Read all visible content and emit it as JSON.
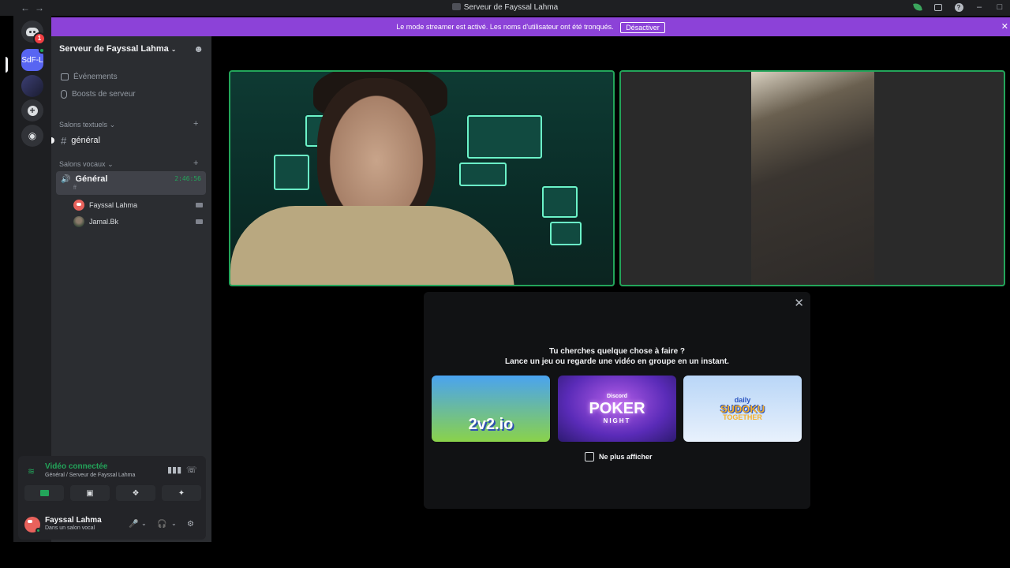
{
  "window": {
    "title": "Serveur de Fayssal Lahma",
    "nav_back": "←",
    "nav_forward": "→",
    "minimize": "–",
    "maximize": "□",
    "help": "?"
  },
  "banner": {
    "text": "Le mode streamer est activé. Les noms d'utilisateur ont été tronqués.",
    "button": "Désactiver",
    "close": "✕"
  },
  "rail": {
    "home_badge": "1",
    "server_abbr": "SdF-L",
    "add_icon": "+",
    "discover_icon": "◉"
  },
  "sidebar": {
    "server_name": "Serveur de Fayssal Lahma",
    "chevron": "⌄",
    "links": [
      "Événements",
      "Boosts de serveur"
    ],
    "text_category": "Salons textuels",
    "voice_category": "Salons vocaux",
    "category_chevron": "⌄",
    "add": "+",
    "text_channel": "général",
    "voice_channel": {
      "name": "Général",
      "timer": "2:46:56",
      "sub": "ff"
    },
    "members": [
      "Fayssal Lahma",
      "Jamal.Bk"
    ]
  },
  "voice_panel": {
    "status": "Vidéo connectée",
    "location": "Général / Serveur de Fayssal Lahma",
    "user_name": "Fayssal Lahma",
    "user_status": "Dans un salon vocal"
  },
  "activity": {
    "close": "✕",
    "title": "Tu cherches quelque chose à faire ?",
    "subtitle": "Lance un jeu ou regarde une vidéo en groupe en un instant.",
    "cards": [
      {
        "name": "2v2.io"
      },
      {
        "brand": "Discord",
        "name": "POKER",
        "sub": "NIGHT"
      },
      {
        "top": "daily",
        "name": "SUDOKU",
        "sub": "TOGETHER"
      }
    ],
    "checkbox_label": "Ne plus afficher"
  },
  "colors": {
    "accent": "#5865f2",
    "banner": "#8c42d8",
    "voice_green": "#23a55a",
    "sidebar": "#2b2d31",
    "rail": "#1e1f22"
  }
}
